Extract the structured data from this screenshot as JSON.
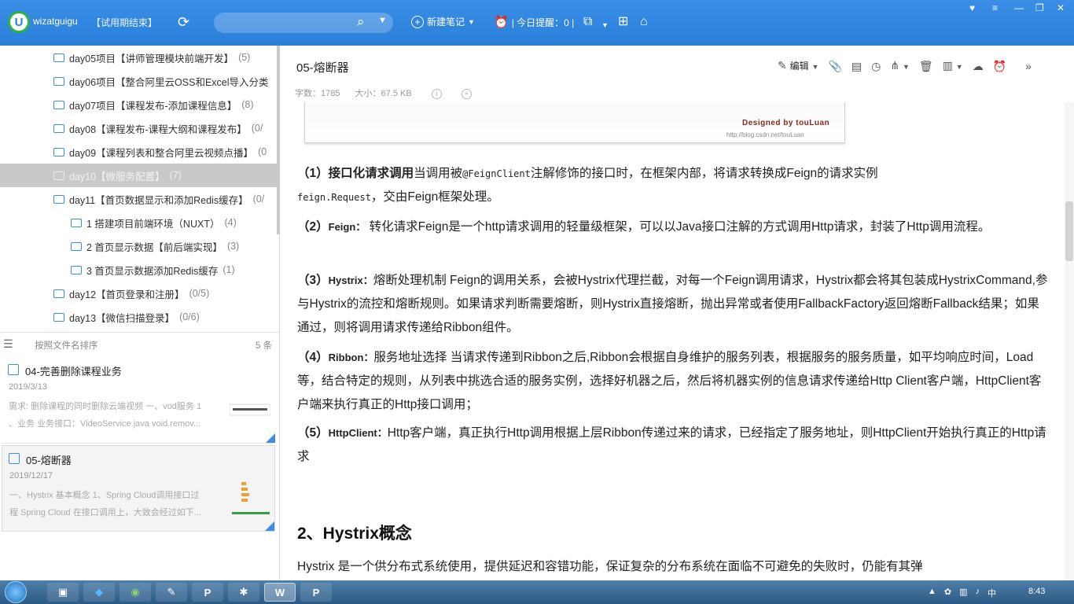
{
  "app": {
    "account": "wizatguigu",
    "trial_label": "【试用期结束】",
    "search_placeholder": "",
    "new_note_label": "新建笔记",
    "reminder_label": "| 今日提醒：0 |",
    "accent_color": "#2a7fd9"
  },
  "sidebar": {
    "items": [
      {
        "label": "day05项目【讲师管理模块前端开发】",
        "count": "(5)"
      },
      {
        "label": "day06项目【整合阿里云OSS和Excel导入分类",
        "count": ""
      },
      {
        "label": "day07项目【课程发布-添加课程信息】",
        "count": "(8)"
      },
      {
        "label": "day08【课程发布-课程大纲和课程发布】",
        "count": "(0/"
      },
      {
        "label": "day09【课程列表和整合阿里云视频点播】",
        "count": "(0"
      },
      {
        "label": "day10【微服务配置】",
        "count": "(7)"
      },
      {
        "label": "day11【首页数据显示和添加Redis缓存】",
        "count": "(0/"
      },
      {
        "label": "1 搭建项目前端环境（NUXT）",
        "count": "(4)"
      },
      {
        "label": "2 首页显示数据【前后端实现】",
        "count": "(3)"
      },
      {
        "label": "3 首页显示数据添加Redis缓存",
        "count": "(1)"
      },
      {
        "label": "day12【首页登录和注册】",
        "count": "(0/5)"
      },
      {
        "label": "day13【微信扫描登录】",
        "count": "(0/6)"
      }
    ],
    "sort_label": "按照文件名排序",
    "sort_count": "5 条",
    "notes": [
      {
        "title": "04-完善删除课程业务",
        "date": "2019/3/13",
        "summary1": "需求: 删除课程的同时删除云端视频 一、vod服务 1",
        "summary2": "、业务 业务接口：VideoService.java void.remov..."
      },
      {
        "title": "05-熔断器",
        "date": "2019/12/17",
        "summary1": "一、Hystrix 基本概念 1、Spring Cloud调用接口过",
        "summary2": "程 Spring Cloud 在接口调用上，大致会经过如下..."
      }
    ]
  },
  "note": {
    "title": "05-熔断器",
    "word_count": "字数：1785",
    "size": "大小：67.5 KB",
    "edit_label": "编辑",
    "image_caption": "Designed by touLuan",
    "image_url": "http://blog.csdn.net/touLuan",
    "p1_num": "（1）",
    "p1_lead": "接口化请求调用",
    "p1_text1": "当调用被",
    "p1_code1": "@FeignClient",
    "p1_text2": "注解修饰的接口时，在框架内部，将请求转换成Feign的请求实例",
    "p1_code2": "feign.Request",
    "p1_text3": "，交由Feign框架处理。",
    "p2_num": "（2）",
    "p2_tag": "Feign：",
    "p2_text": "转化请求Feign是一个http请求调用的轻量级框架，可以以Java接口注解的方式调用Http请求，封装了Http调用流程。",
    "p3_num": "（3）",
    "p3_tag": "Hystrix：",
    "p3_text": "熔断处理机制 Feign的调用关系，会被Hystrix代理拦截，对每一个Feign调用请求，Hystrix都会将其包装成HystrixCommand,参与Hystrix的流控和熔断规则。如果请求判断需要熔断，则Hystrix直接熔断，抛出异常或者使用FallbackFactory返回熔断Fallback结果；如果通过，则将调用请求传递给Ribbon组件。",
    "p4_num": "（4）",
    "p4_tag": "Ribbon：",
    "p4_text": "服务地址选择 当请求传递到Ribbon之后,Ribbon会根据自身维护的服务列表，根据服务的服务质量，如平均响应时间，Load等，结合特定的规则，从列表中挑选合适的服务实例，选择好机器之后，然后将机器实例的信息请求传递给Http Client客户端，HttpClient客户端来执行真正的Http接口调用；",
    "p5_num": "（5）",
    "p5_tag": "HttpClient：",
    "p5_text": "Http客户端，真正执行Http调用根据上层Ribbon传递过来的请求，已经指定了服务地址，则HttpClient开始执行真正的Http请求",
    "section_title": "2、Hystrix概念",
    "section_text": "Hystrix 是一个供分布式系统使用，提供延迟和容错功能，保证复杂的分布系统在面临不可避免的失败时，仍能有其弹"
  },
  "taskbar": {
    "clock": "8:43"
  }
}
